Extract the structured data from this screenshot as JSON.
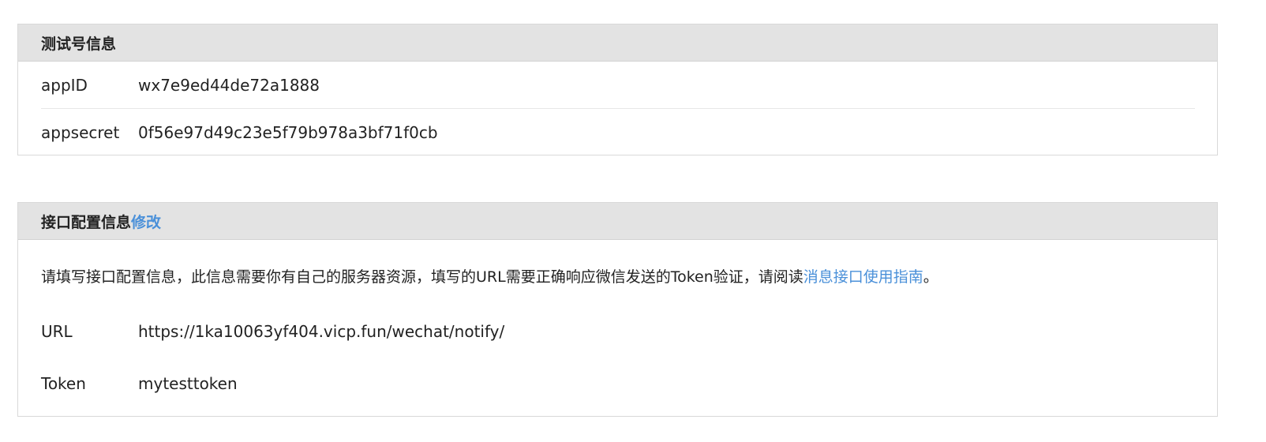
{
  "test_account": {
    "title": "测试号信息",
    "appid_label": "appID",
    "appid_value": "wx7e9ed44de72a1888",
    "appsecret_label": "appsecret",
    "appsecret_value": "0f56e97d49c23e5f79b978a3bf71f0cb"
  },
  "interface_config": {
    "title": "接口配置信息",
    "edit_link": "修改",
    "description_text": "请填写接口配置信息，此信息需要你有自己的服务器资源，填写的URL需要正确响应微信发送的Token验证，请阅读",
    "description_link": "消息接口使用指南",
    "description_end": "。",
    "url_label": "URL",
    "url_value": "https://1ka10063yf404.vicp.fun/wechat/notify/",
    "token_label": "Token",
    "token_value": "mytesttoken"
  },
  "colors": {
    "link": "#4a90d9",
    "header_bg": "#e3e3e3",
    "border": "#d9d9d9"
  }
}
